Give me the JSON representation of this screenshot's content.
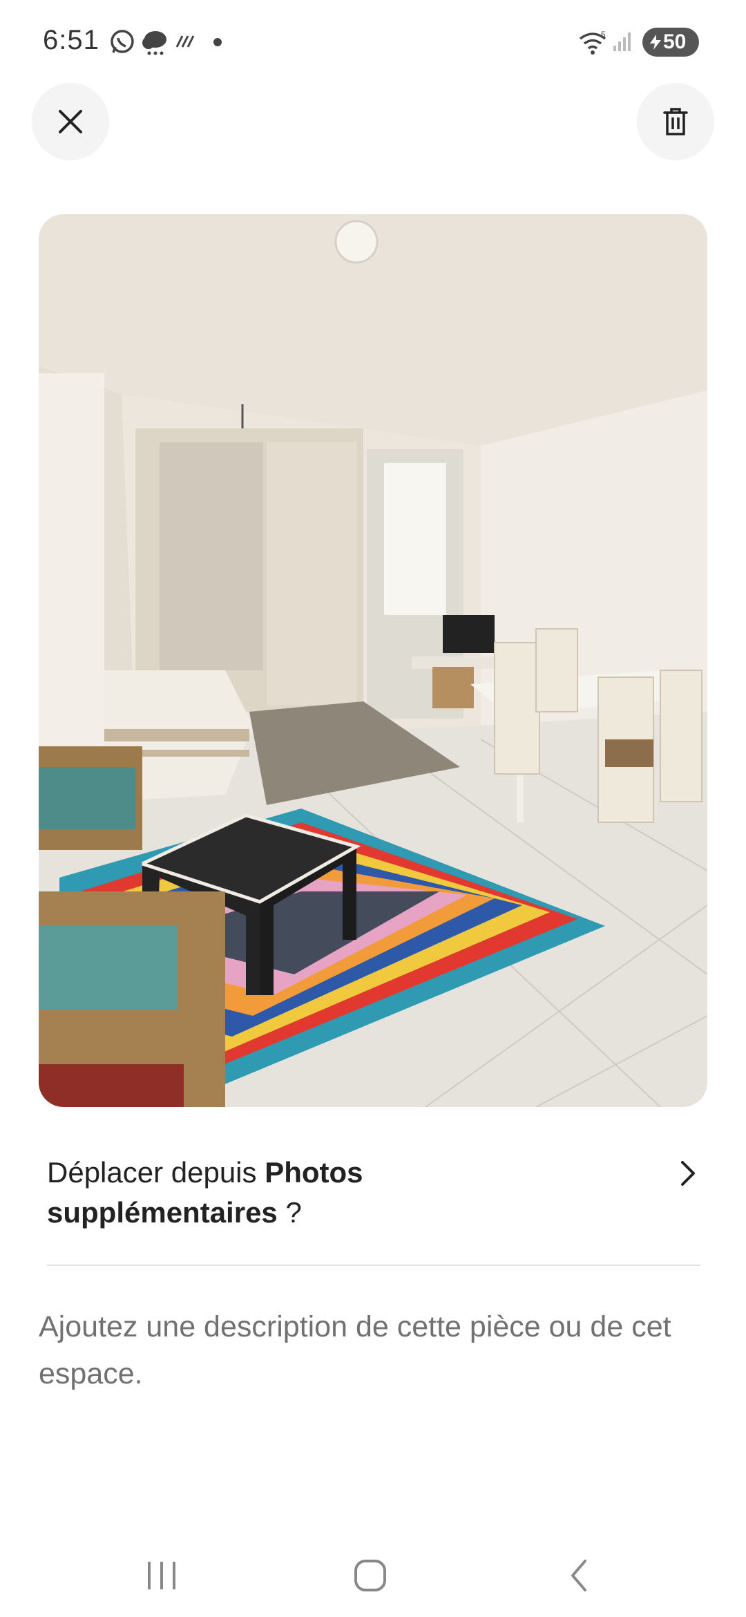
{
  "status_bar": {
    "time": "6:51",
    "battery_level": "50",
    "icons": [
      "whatsapp-icon",
      "weather-cloud-icon",
      "rain-icon",
      "notification-dot-icon",
      "wifi-icon",
      "signal-icon",
      "battery-icon"
    ]
  },
  "header": {
    "close_icon": "close-icon",
    "delete_icon": "trash-icon"
  },
  "photo": {
    "subject": "room-photo"
  },
  "move_row": {
    "prefix": "Déplacer depuis ",
    "album": "Photos supplémentaires",
    "suffix": " ?",
    "icon": "chevron-right-icon"
  },
  "description": {
    "placeholder": "Ajoutez une description de cette pièce ou de cet espace."
  },
  "nav_bar": {
    "icons": [
      "recent-apps-icon",
      "home-icon",
      "back-icon"
    ]
  },
  "colors": {
    "text_primary": "#222222",
    "text_secondary": "#717171",
    "button_bg": "#f4f4f4",
    "divider": "#e2e2e2"
  }
}
